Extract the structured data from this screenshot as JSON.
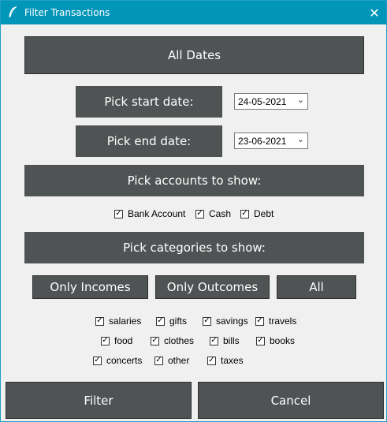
{
  "window": {
    "title": "Filter Transactions"
  },
  "all_dates_label": "All Dates",
  "start_date": {
    "label": "Pick start date:",
    "value": "24-05-2021"
  },
  "end_date": {
    "label": "Pick end date:",
    "value": "23-06-2021"
  },
  "accounts": {
    "header": "Pick accounts to show:",
    "items": [
      {
        "label": "Bank Account",
        "checked": true
      },
      {
        "label": "Cash",
        "checked": true
      },
      {
        "label": "Debt",
        "checked": true
      }
    ]
  },
  "categories": {
    "header": "Pick categories to show:",
    "filters": {
      "only_incomes": "Only Incomes",
      "only_outcomes": "Only Outcomes",
      "all": "All"
    },
    "items": [
      {
        "label": "salaries",
        "checked": true
      },
      {
        "label": "gifts",
        "checked": true
      },
      {
        "label": "savings",
        "checked": true
      },
      {
        "label": "travels",
        "checked": true
      },
      {
        "label": "food",
        "checked": true
      },
      {
        "label": "clothes",
        "checked": true
      },
      {
        "label": "bills",
        "checked": true
      },
      {
        "label": "books",
        "checked": true
      },
      {
        "label": "concerts",
        "checked": true
      },
      {
        "label": "other",
        "checked": true
      },
      {
        "label": "taxes",
        "checked": true
      }
    ]
  },
  "actions": {
    "filter": "Filter",
    "cancel": "Cancel"
  },
  "icons": {
    "app": "feather-icon",
    "close": "close-icon",
    "dropdown": "chevron-down-icon",
    "check": "checkmark-icon"
  },
  "colors": {
    "titlebar": "#0095b9",
    "button": "#4f5354",
    "background": "#f0f0f0"
  }
}
